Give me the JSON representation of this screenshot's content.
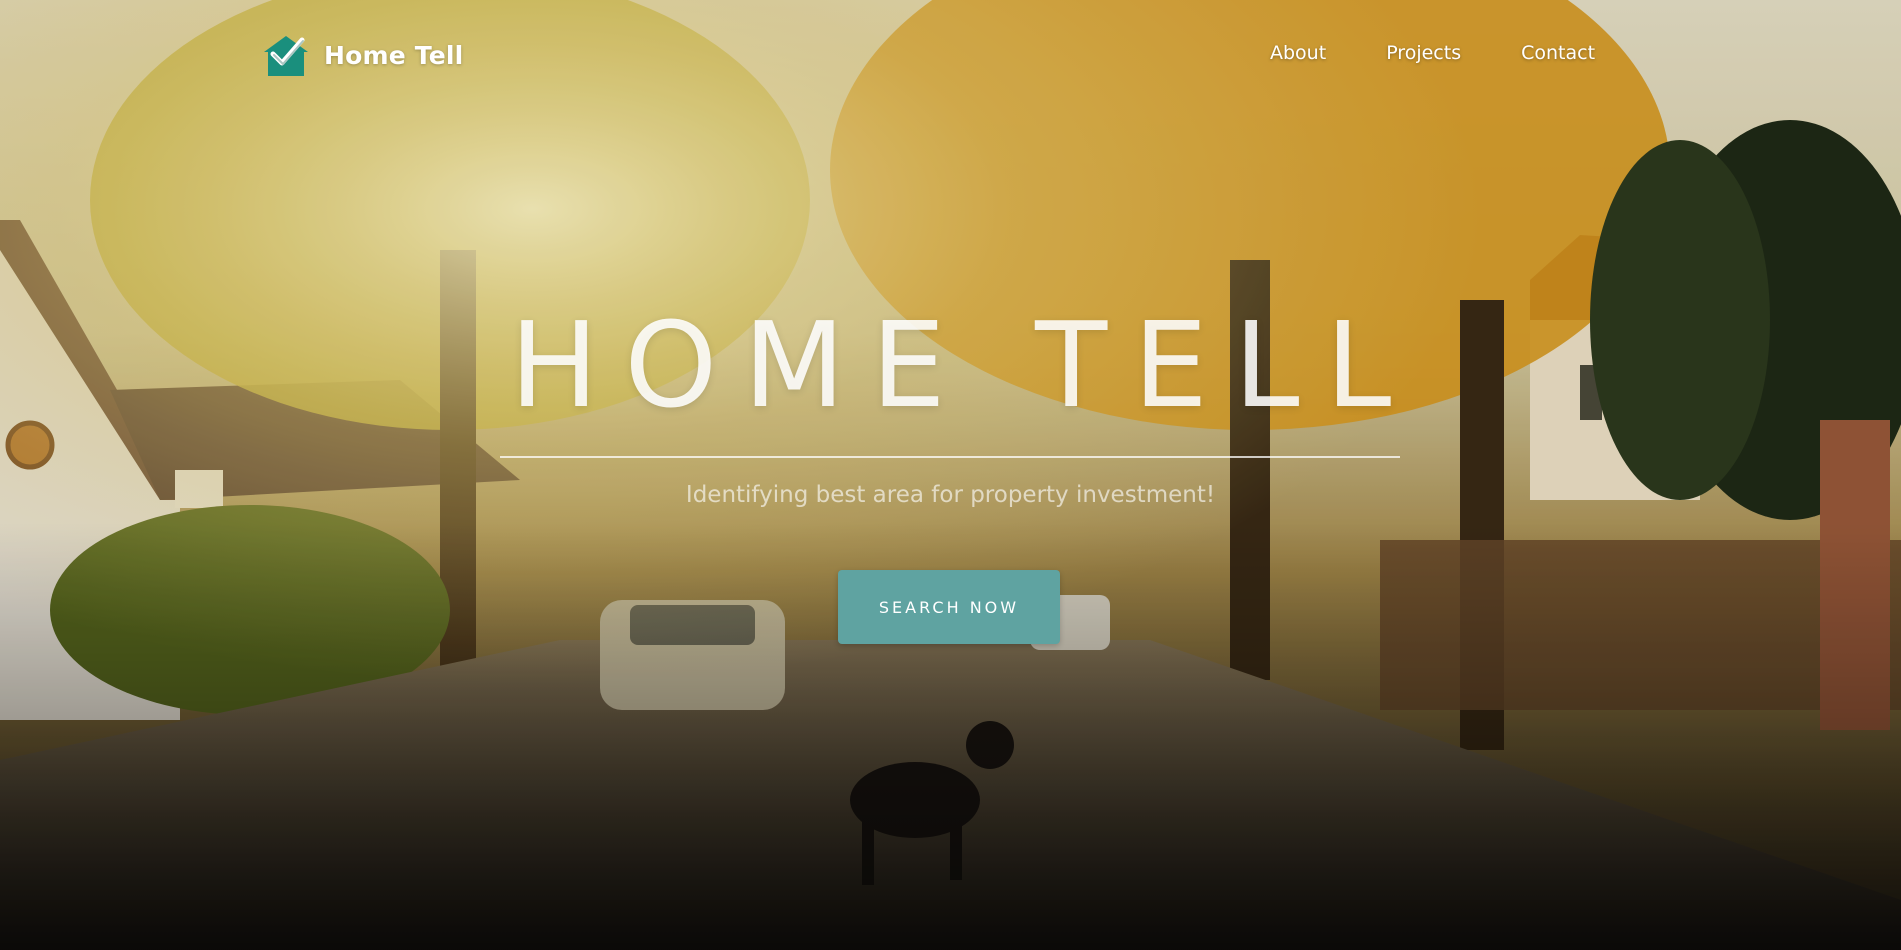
{
  "brand": {
    "name": "Home Tell",
    "logo_icon": "house-check-icon",
    "logo_color": "#1a8f7d"
  },
  "nav": {
    "items": [
      {
        "label": "About"
      },
      {
        "label": "Projects"
      },
      {
        "label": "Contact"
      }
    ]
  },
  "hero": {
    "title": "HOME TELL",
    "tagline": "Identifying best area for property investment!",
    "cta_label": "SEARCH NOW",
    "cta_color": "#5fa3a1",
    "background_image": "autumn-residential-street-photo"
  }
}
